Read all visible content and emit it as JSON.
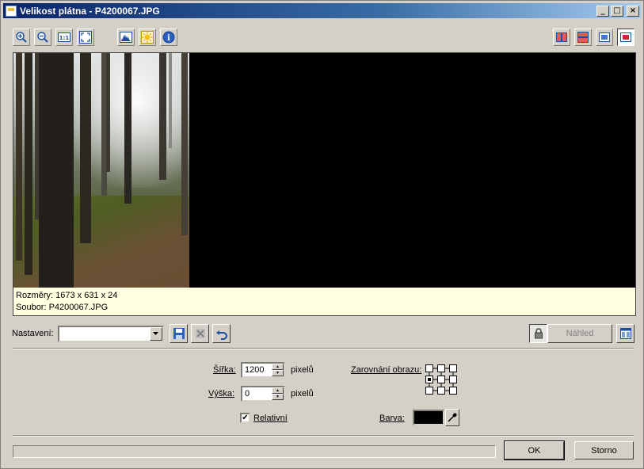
{
  "window": {
    "title": "Velikost plátna - P4200067.JPG",
    "controls": {
      "minimize": "_",
      "maximize": "□",
      "close": "×"
    }
  },
  "toolbar": {
    "left": [
      {
        "name": "zoom-in",
        "icon": "zoom-in-icon"
      },
      {
        "name": "zoom-out",
        "icon": "zoom-out-icon"
      },
      {
        "name": "actual-size",
        "icon": "actual-size-icon",
        "text": "1:1"
      },
      {
        "name": "fit-window",
        "icon": "fit-window-icon"
      },
      {
        "name": "histogram",
        "icon": "histogram-icon"
      },
      {
        "name": "highlight",
        "icon": "sun-icon"
      },
      {
        "name": "info",
        "icon": "info-icon",
        "text": "i"
      }
    ],
    "right": [
      {
        "name": "split-vertical",
        "icon": "split-vertical-icon"
      },
      {
        "name": "split-horizontal",
        "icon": "split-horizontal-icon"
      },
      {
        "name": "single-view-blue",
        "icon": "single-view-icon"
      },
      {
        "name": "single-view-red",
        "icon": "single-view-icon"
      }
    ]
  },
  "info": {
    "dimensions": "Rozměry: 1673 x 631 x 24",
    "file": "Soubor: P4200067.JPG"
  },
  "settings": {
    "label": "Nastavení:",
    "value": "",
    "preview_label": "Náhled"
  },
  "form": {
    "width_label": "Šířka:",
    "width_value": "1200",
    "width_unit": "pixelů",
    "height_label": "Výška:",
    "height_value": "0",
    "height_unit": "pixelů",
    "relative_label": "Relativní",
    "relative_checked": true,
    "checkmark": "✔",
    "alignment_label": "Zarovnání obrazu:",
    "alignment_selected": "middle-left",
    "color_label": "Barva:",
    "color_value": "#000000"
  },
  "buttons": {
    "ok": "OK",
    "cancel": "Storno"
  }
}
